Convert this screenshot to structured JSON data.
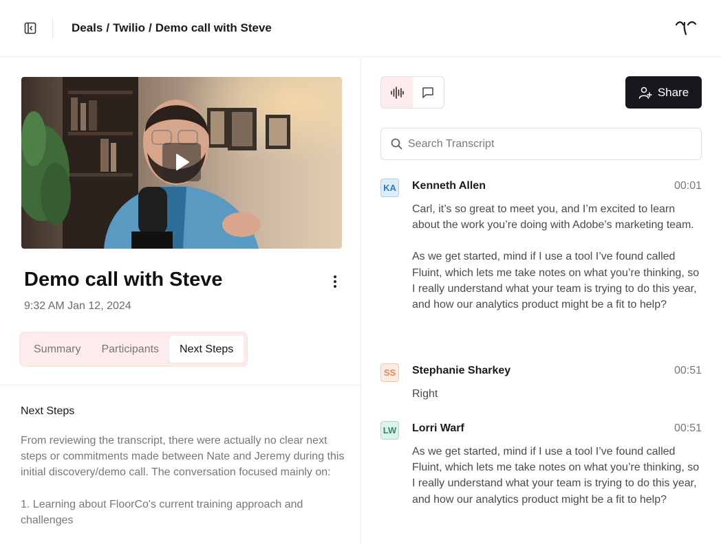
{
  "breadcrumb": {
    "items": [
      "Deals",
      "Twilio",
      "Demo call with Steve"
    ],
    "separator": "/"
  },
  "meeting": {
    "title": "Demo call with Steve",
    "datetime": "9:32 AM Jan 12, 2024"
  },
  "tabs": [
    {
      "label": "Summary",
      "active": false
    },
    {
      "label": "Participants",
      "active": false
    },
    {
      "label": "Next Steps",
      "active": true
    }
  ],
  "next_steps": {
    "heading": "Next Steps",
    "paragraphs": [
      "From reviewing the transcript, there were actually no clear next steps or commitments made between Nate and Jeremy during this initial discovery/demo call. The conversation focused mainly on:",
      "1. Learning about FloorCo's current training approach and challenges"
    ]
  },
  "toolbar": {
    "share_label": "Share",
    "mode_icons": [
      "audio-waveform-icon",
      "chat-bubble-icon"
    ]
  },
  "search": {
    "placeholder": "Search Transcript"
  },
  "transcript": [
    {
      "initials": "KA",
      "name": "Kenneth Allen",
      "time": "00:01",
      "color": "#2a7ab8",
      "bg": "#dcedfa",
      "border": "#a9d0ef",
      "paragraphs": [
        "Carl, it’s so great to meet you, and I’m excited to learn about the work you’re doing with Adobe’s marketing team.",
        "As we get started, mind if I use a tool I’ve found called Fluint, which lets me take notes on what you’re thinking, so I really understand what your team is trying to do this year, and how our analytics product might be a fit to help?"
      ]
    },
    {
      "initials": "SS",
      "name": "Stephanie Sharkey",
      "time": "00:51",
      "color": "#e08a5b",
      "bg": "#fdebe1",
      "border": "#f6c7ad",
      "paragraphs": [
        "Right"
      ]
    },
    {
      "initials": "LW",
      "name": "Lorri Warf",
      "time": "00:51",
      "color": "#2f8a6d",
      "bg": "#ddf2ea",
      "border": "#a8dcc8",
      "paragraphs": [
        "As we get started, mind if I use a tool I’ve found called Fluint, which lets me take notes on what you’re thinking, so I really understand what your team is trying to do this year, and how our analytics product might be a fit to help?"
      ]
    }
  ]
}
